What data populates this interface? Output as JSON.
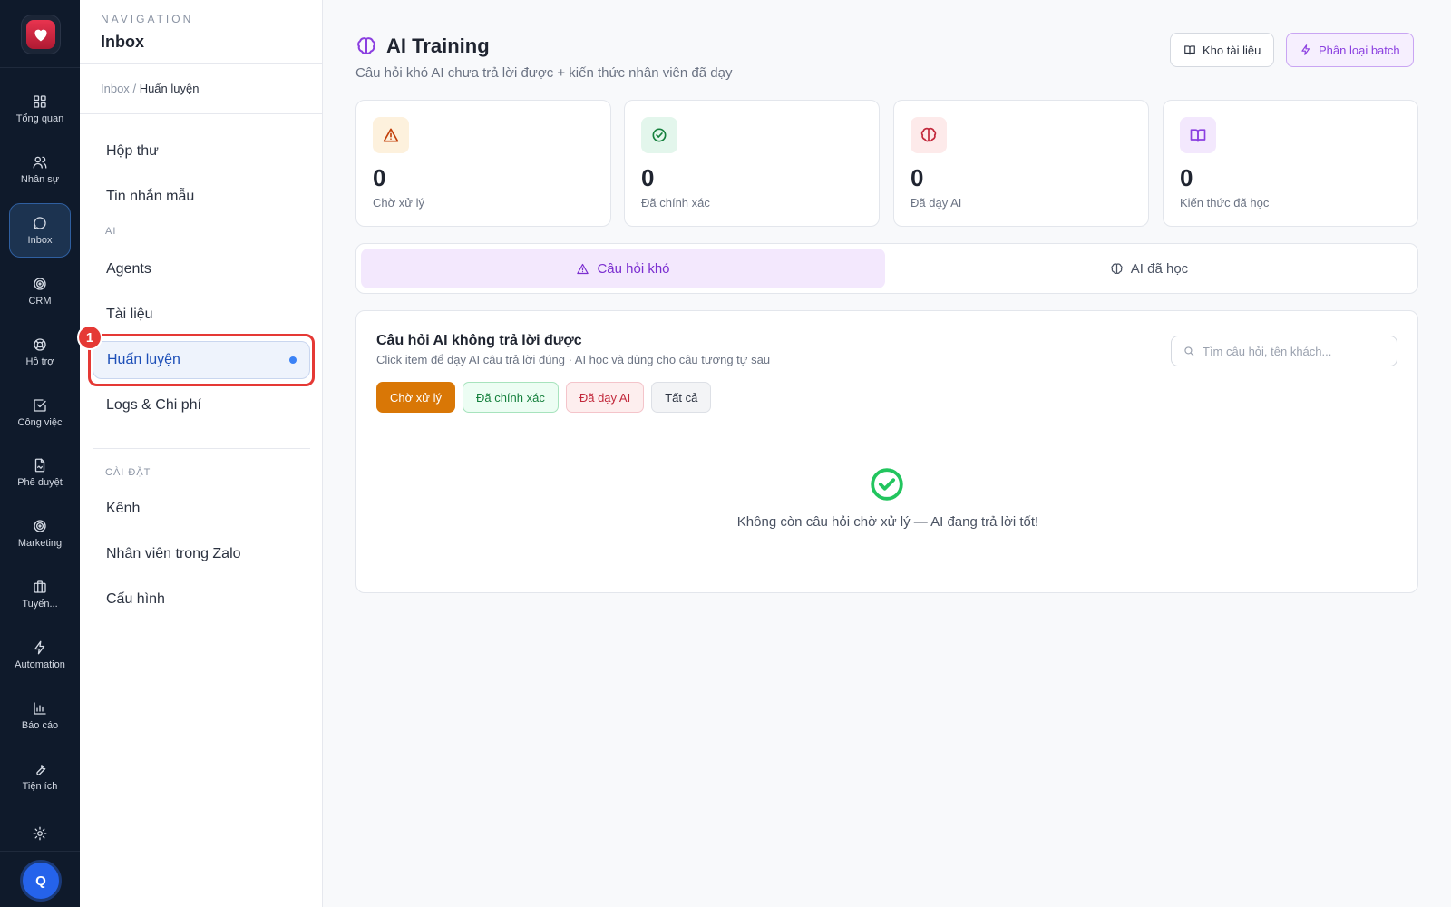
{
  "rail": {
    "items": [
      {
        "label": "Tổng quan",
        "icon": "grid-icon"
      },
      {
        "label": "Nhân sự",
        "icon": "users-icon"
      },
      {
        "label": "Inbox",
        "icon": "chat-icon"
      },
      {
        "label": "CRM",
        "icon": "target-icon"
      },
      {
        "label": "Hỗ trợ",
        "icon": "lifebuoy-icon"
      },
      {
        "label": "Công việc",
        "icon": "checkbox-icon"
      },
      {
        "label": "Phê duyệt",
        "icon": "file-sign-icon"
      },
      {
        "label": "Marketing",
        "icon": "target-icon"
      },
      {
        "label": "Tuyển...",
        "icon": "briefcase-icon"
      },
      {
        "label": "Automation",
        "icon": "bolt-icon"
      },
      {
        "label": "Báo cáo",
        "icon": "bar-chart-icon"
      },
      {
        "label": "Tiện ích",
        "icon": "wrench-icon"
      }
    ],
    "avatar_initial": "Q"
  },
  "nav": {
    "eyebrow": "NAVIGATION",
    "title": "Inbox",
    "breadcrumb": {
      "root": "Inbox",
      "sep": "/",
      "current": "Huấn luyện"
    },
    "items_top": [
      {
        "label": "Hộp thư"
      },
      {
        "label": "Tin nhắn mẫu"
      }
    ],
    "group_ai": "AI",
    "items_ai": [
      {
        "label": "Agents"
      },
      {
        "label": "Tài liệu"
      },
      {
        "label": "Huấn luyện"
      },
      {
        "label": "Logs & Chi phí"
      }
    ],
    "group_settings": "CÀI ĐẶT",
    "items_settings": [
      {
        "label": "Kênh"
      },
      {
        "label": "Nhân viên trong Zalo"
      },
      {
        "label": "Cấu hình"
      }
    ],
    "step_badge": "1"
  },
  "main": {
    "title": "AI Training",
    "subtitle": "Câu hỏi khó AI chưa trả lời được + kiến thức nhân viên đã dạy",
    "btn_docs": "Kho tài liệu",
    "btn_batch": "Phân loại batch",
    "stats": [
      {
        "value": "0",
        "label": "Chờ xử lý"
      },
      {
        "value": "0",
        "label": "Đã chính xác"
      },
      {
        "value": "0",
        "label": "Đã dạy AI"
      },
      {
        "value": "0",
        "label": "Kiến thức đã học"
      }
    ],
    "tabs": {
      "hard": "Câu hỏi khó",
      "learned": "AI đã học"
    },
    "panel": {
      "title": "Câu hỏi AI không trả lời được",
      "subtitle": "Click item để dạy AI câu trả lời đúng · AI học và dùng cho câu tương tự sau",
      "search_placeholder": "Tìm câu hỏi, tên khách...",
      "filters": [
        "Chờ xử lý",
        "Đã chính xác",
        "Đã dạy AI",
        "Tất cả"
      ],
      "empty_text": "Không còn câu hỏi chờ xử lý — AI đang trả lời tốt!"
    }
  }
}
